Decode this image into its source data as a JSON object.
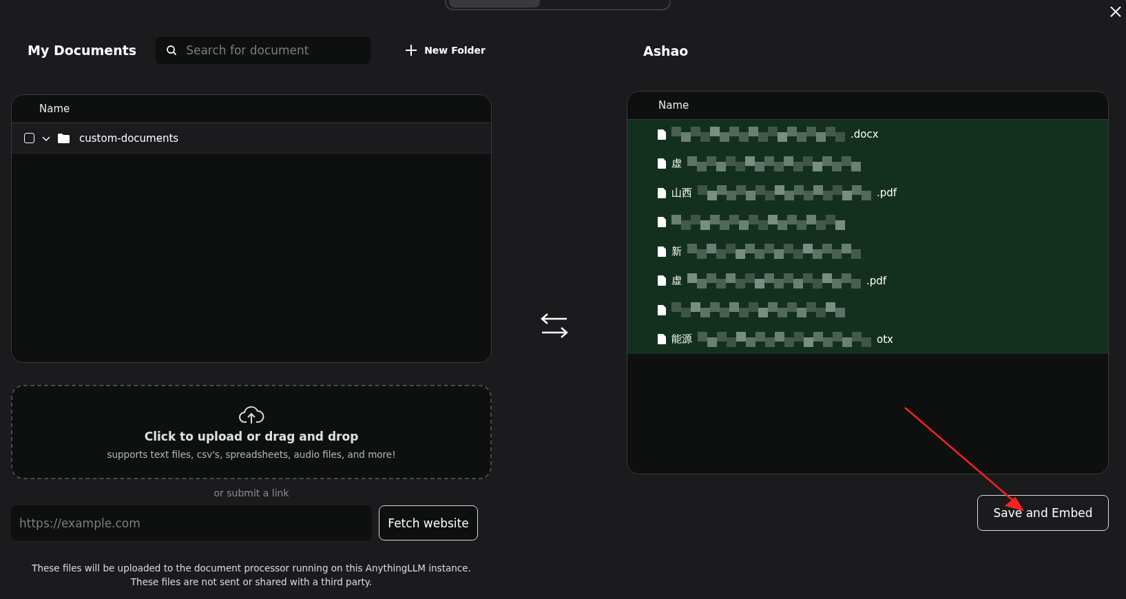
{
  "left": {
    "title": "My Documents",
    "search": {
      "placeholder": "Search for document"
    },
    "new_folder": "New Folder",
    "table": {
      "columns": [
        "Name"
      ],
      "rows": [
        {
          "name": "custom-documents",
          "checked": false,
          "expanded": true
        }
      ]
    },
    "upload": {
      "title": "Click to upload or drag and drop",
      "subtitle": "supports text files, csv's, spreadsheets, audio files, and more!"
    },
    "link_label": "or submit a link",
    "url": {
      "placeholder": "https://example.com"
    },
    "fetch_button": "Fetch website",
    "notice": [
      "These files will be uploaded to the document processor running on this AnythingLLM instance.",
      "These files are not sent or shared with a third party."
    ]
  },
  "right": {
    "title": "Ashao",
    "table": {
      "columns": [
        "Name"
      ],
      "rows": [
        {
          "tail": ".docx"
        },
        {
          "head": "虚"
        },
        {
          "head": "山西",
          "tail": ".pdf"
        },
        {},
        {
          "head": "新"
        },
        {
          "head": "虚",
          "tail": ".pdf"
        },
        {},
        {
          "head": "能源",
          "tail": "otx"
        }
      ]
    },
    "save_button": "Save and Embed"
  }
}
